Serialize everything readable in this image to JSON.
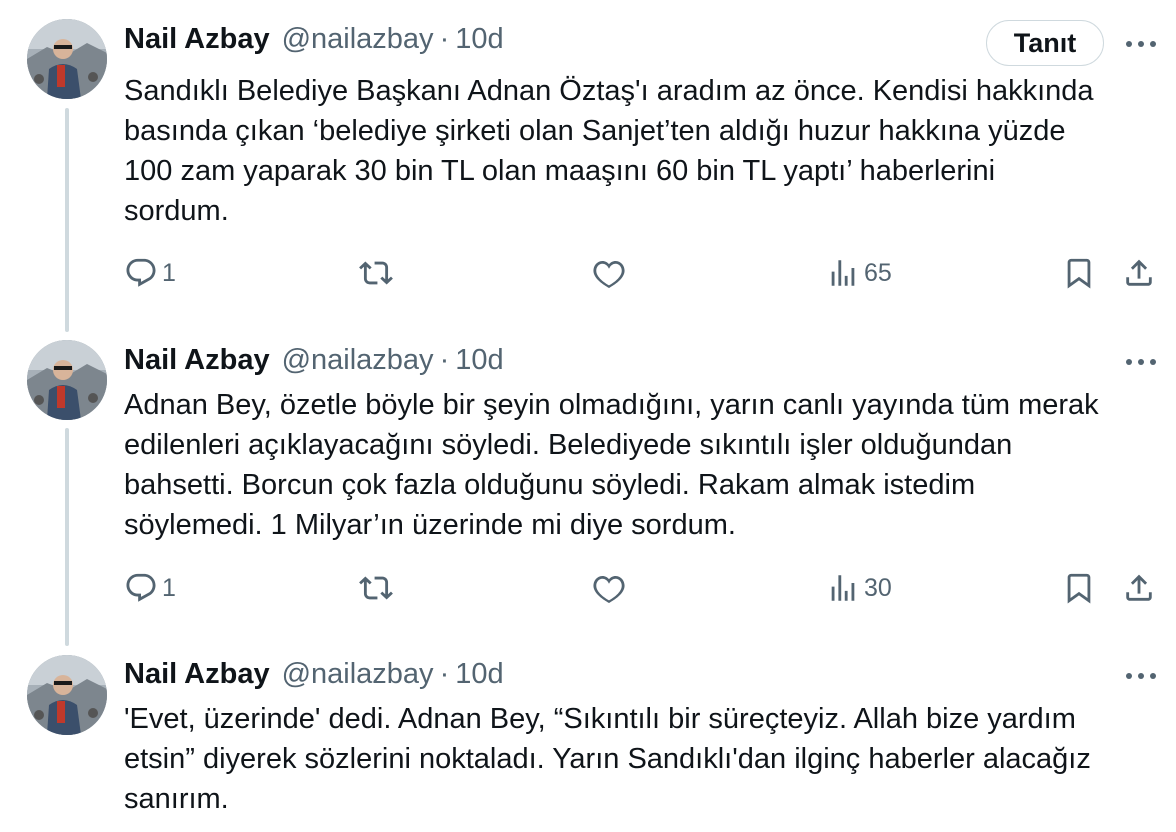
{
  "follow_label": "Tanıt",
  "tweets": [
    {
      "name": "Nail Azbay",
      "handle": "@nailazbay",
      "separator": "·",
      "time": "10d",
      "text": "Sandıklı Belediye Başkanı Adnan Öztaş'ı aradım az önce. Kendisi hakkında\nbasında çıkan ‘belediye şirketi olan Sanjet’ten aldığı huzur hakkına yüzde\n100 zam yaparak 30 bin TL olan maaşını 60 bin TL yaptı’ haberlerini\nsordum.",
      "replies": "1",
      "views": "65"
    },
    {
      "name": "Nail Azbay",
      "handle": "@nailazbay",
      "separator": "·",
      "time": "10d",
      "text": "Adnan Bey, özetle böyle bir şeyin olmadığını, yarın canlı yayında tüm merak\nedilenleri açıklayacağını söyledi. Belediyede sıkıntılı işler olduğundan\nbahsetti. Borcun çok fazla olduğunu söyledi. Rakam almak istedim\nsöylemedi. 1 Milyar’ın üzerinde mi diye sordum.",
      "replies": "1",
      "views": "30"
    },
    {
      "name": "Nail Azbay",
      "handle": "@nailazbay",
      "separator": "·",
      "time": "10d",
      "text": "'Evet, üzerinde' dedi. Adnan Bey, “Sıkıntılı bir süreçteyiz. Allah bize yardım\netsin” diyerek sözlerini noktaladı. Yarın Sandıklı'dan ilginç haberler alacağız\nsanırım."
    }
  ]
}
